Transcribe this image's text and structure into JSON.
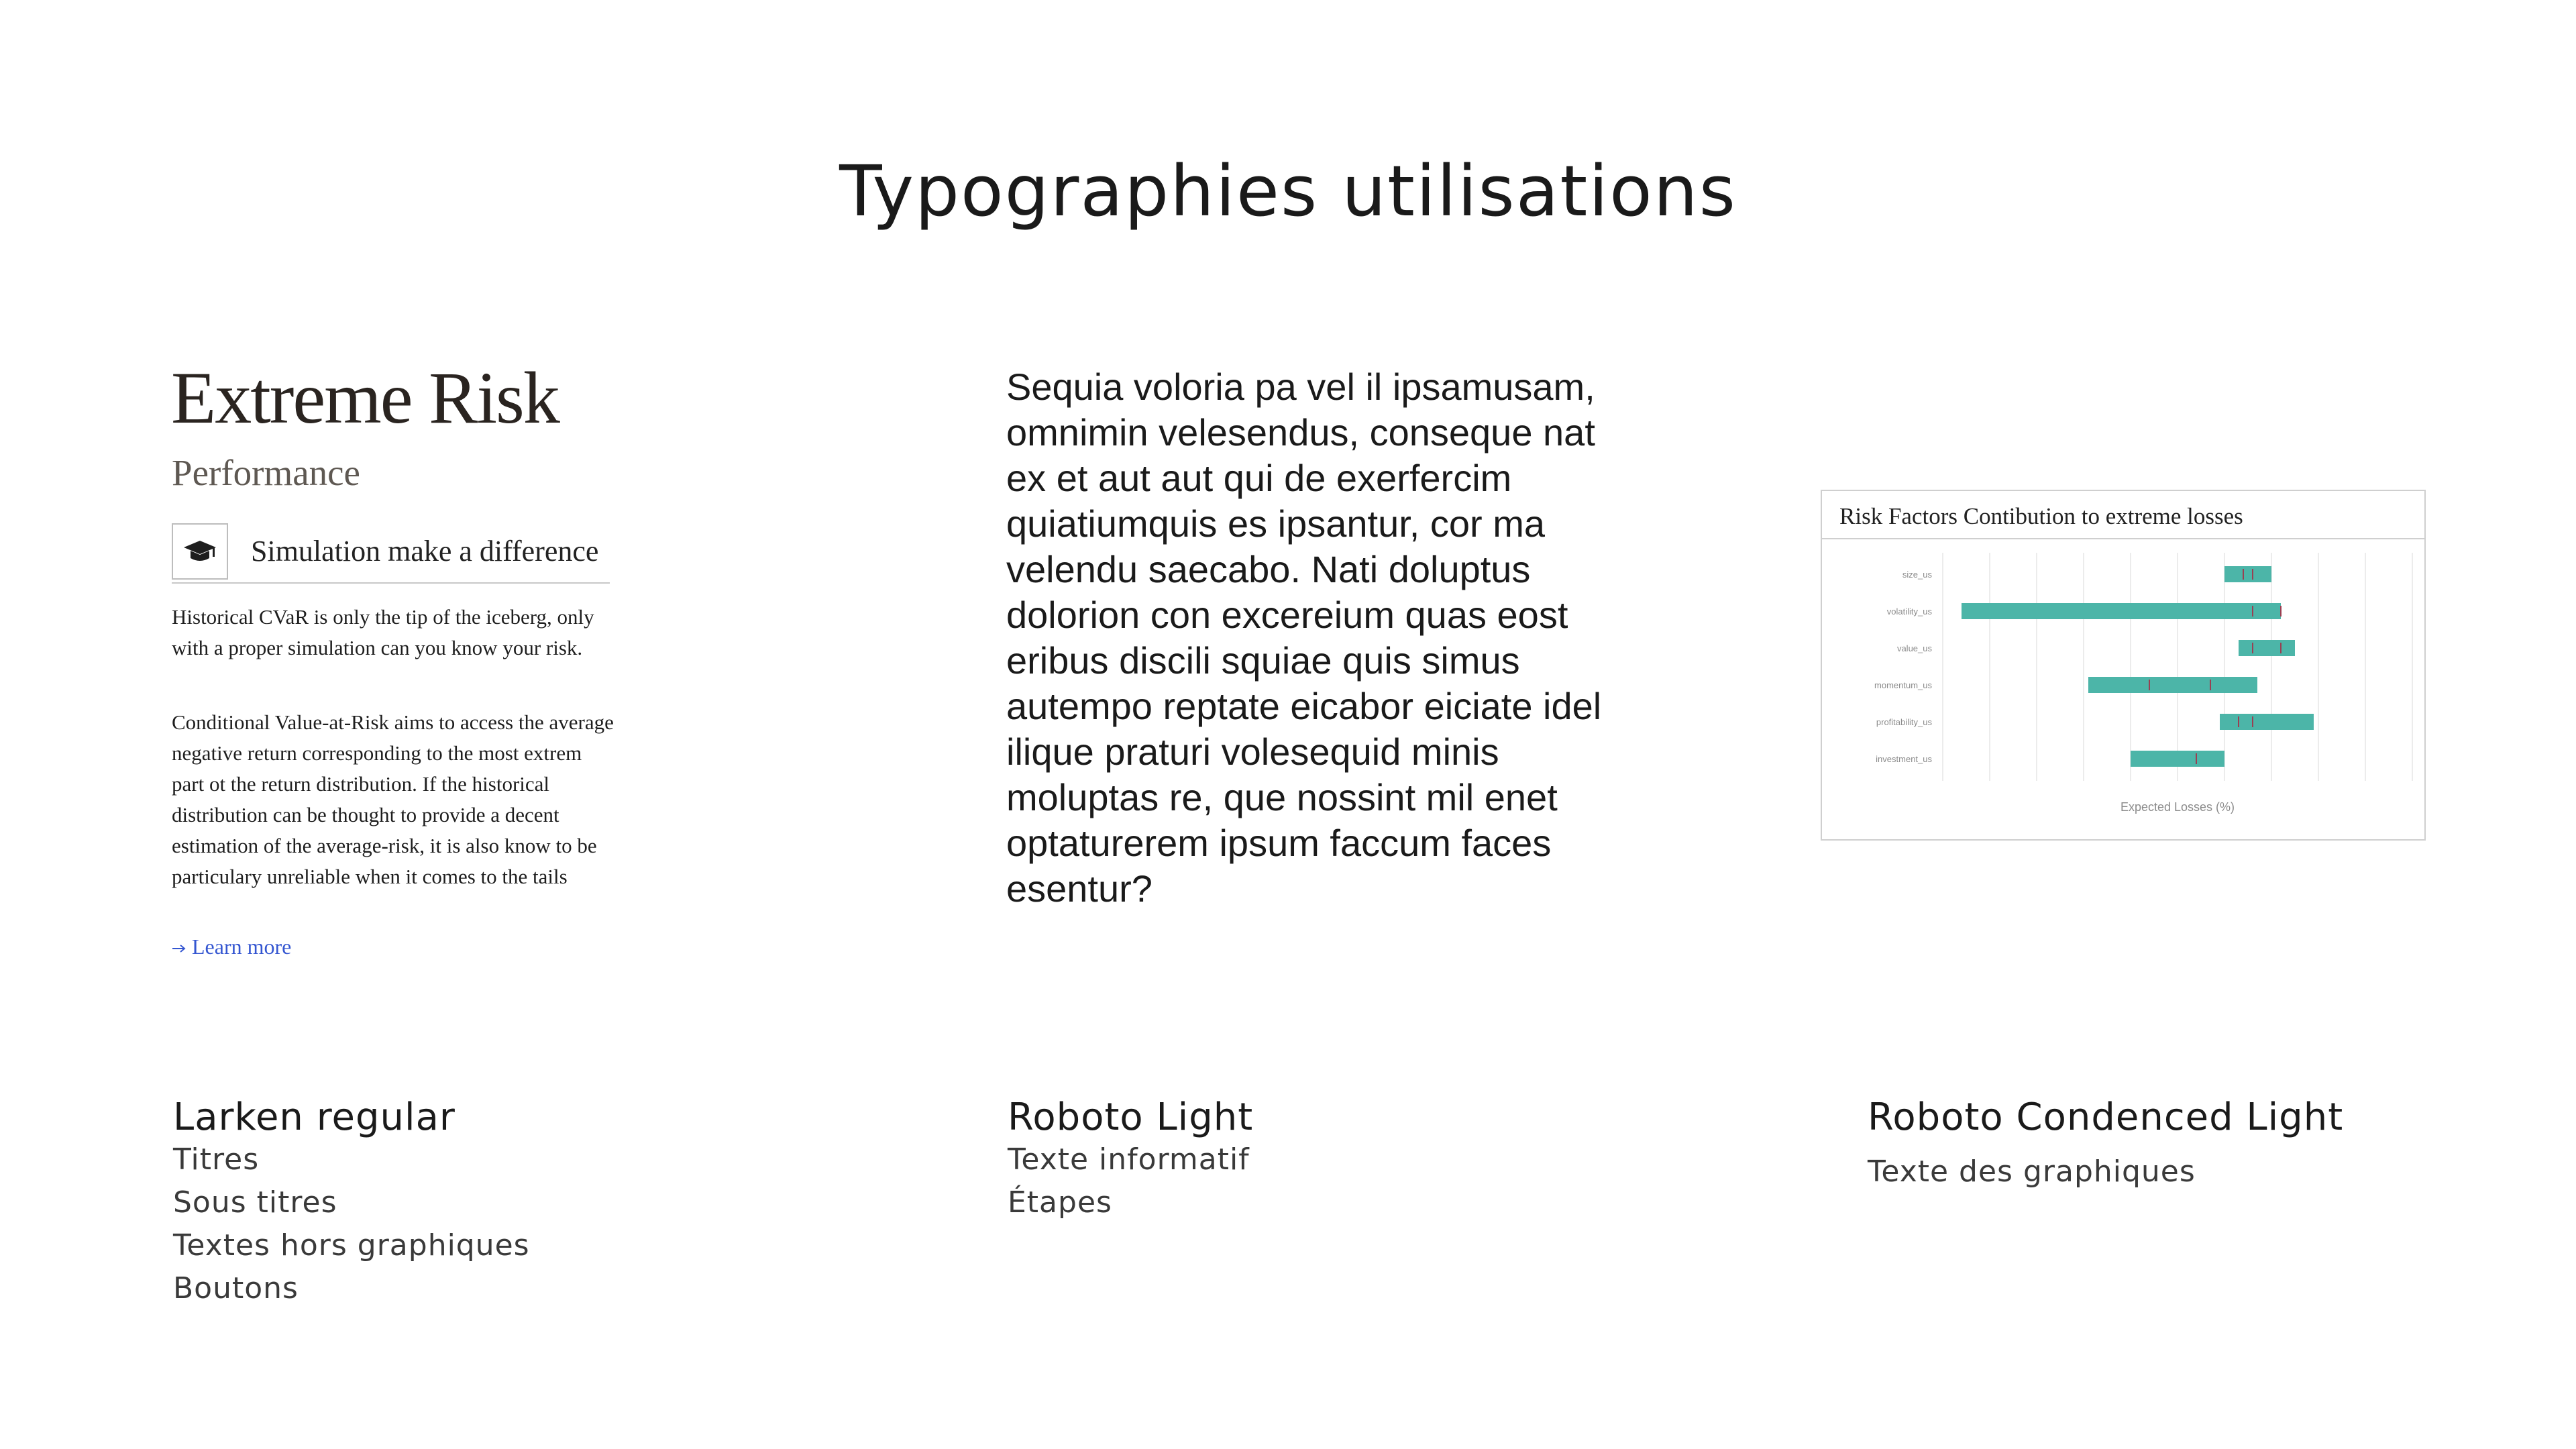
{
  "page": {
    "title": "Typographies utilisations"
  },
  "sample_card": {
    "title": "Extreme Risk",
    "subtitle": "Performance",
    "feature": {
      "icon": "graduation-cap-icon",
      "label": "Simulation make a difference"
    },
    "paragraphs": [
      "Historical CVaR is only the tip of the iceberg, only with a proper simulation can you know your risk.",
      "Conditional Value-at-Risk aims to access the average negative return corresponding to the most extrem part ot the return distribution. If the historical distribution can be thought to provide a decent estimation of the average-risk, it is also know to be particulary unreliable when it comes to the tails"
    ],
    "link": {
      "icon": "arrow-right-icon",
      "label": "Learn more"
    },
    "colors": {
      "link": "#3456d1",
      "title": "#2a2420"
    }
  },
  "informative_text": "Sequia voloria pa vel il ipsamusam, omnimin velesendus, conseque nat ex et aut aut qui de exerfercim quiatiumquis es ipsantur, cor ma velendu saecabo. Nati doluptus dolorion con excereium quas eost eribus discili squiae quis simus autempo reptate eicabor eiciate idel ilique praturi volesequid minis moluptas re, que nossint mil enet optaturerem ipsum faccum faces esentur?",
  "chart_data": {
    "type": "bar",
    "title": "Risk Factors Contibution to extreme losses",
    "xlabel": "Expected Losses (%)",
    "ylabel": "",
    "orientation": "horizontal-range",
    "x_range": [
      0,
      100
    ],
    "grid": true,
    "bar_color": "#4cb5a8",
    "marker_color": "#9a3f52",
    "categories": [
      "size_us",
      "volatility_us",
      "value_us",
      "momentum_us",
      "profitability_us",
      "investment_us"
    ],
    "ranges": [
      {
        "start": 60,
        "end": 70,
        "markers": [
          64,
          66
        ]
      },
      {
        "start": 4,
        "end": 72,
        "markers": [
          66,
          72
        ]
      },
      {
        "start": 63,
        "end": 75,
        "markers": [
          66,
          72
        ]
      },
      {
        "start": 31,
        "end": 67,
        "markers": [
          44,
          57
        ]
      },
      {
        "start": 59,
        "end": 79,
        "markers": [
          63,
          66
        ]
      },
      {
        "start": 40,
        "end": 60,
        "markers": [
          54
        ]
      }
    ]
  },
  "legend": [
    {
      "font": "Larken regular",
      "usages": [
        "Titres",
        "Sous titres",
        "Textes hors graphiques",
        "Boutons"
      ]
    },
    {
      "font": "Roboto Light",
      "usages": [
        "Texte informatif",
        "Étapes"
      ]
    },
    {
      "font": "Roboto Condenced Light",
      "usages": [
        "Texte des graphiques"
      ]
    }
  ]
}
